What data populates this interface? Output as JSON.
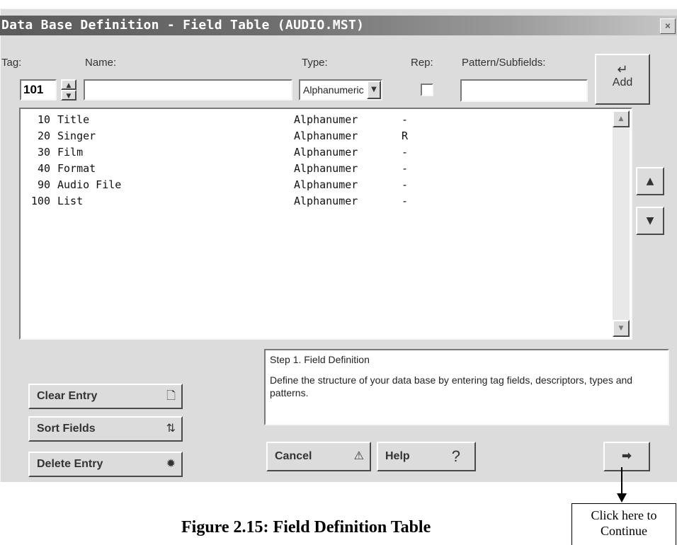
{
  "window": {
    "title": "Data Base Definition - Field Table (AUDIO.MST)",
    "close_label": "×"
  },
  "labels": {
    "tag": "Tag:",
    "name": "Name:",
    "type": "Type:",
    "rep": "Rep:",
    "pattern": "Pattern/Subfields:"
  },
  "form": {
    "tag_value": "101",
    "name_value": "",
    "type_value": "Alphanumeric",
    "rep_checked": false,
    "pattern_value": ""
  },
  "add_button": {
    "label": "Add",
    "icon": "return-arrow-icon"
  },
  "fields": [
    {
      "tag": "10",
      "name": "Title",
      "type": "Alphanumer",
      "rep": "-"
    },
    {
      "tag": "20",
      "name": "Singer",
      "type": "Alphanumer",
      "rep": "R"
    },
    {
      "tag": "30",
      "name": "Film",
      "type": "Alphanumer",
      "rep": "-"
    },
    {
      "tag": "40",
      "name": "Format",
      "type": "Alphanumer",
      "rep": "-"
    },
    {
      "tag": "90",
      "name": "Audio File",
      "type": "Alphanumer",
      "rep": "-"
    },
    {
      "tag": "100",
      "name": "List",
      "type": "Alphanumer",
      "rep": "-"
    }
  ],
  "help": {
    "title": "Step 1. Field Definition",
    "text": "Define the structure of your data base by entering tag fields, descriptors, types and patterns."
  },
  "buttons": {
    "clear_entry": "Clear Entry",
    "sort_fields": "Sort Fields",
    "delete_entry": "Delete Entry",
    "cancel": "Cancel",
    "help": "Help",
    "help_icon": "?"
  },
  "annotation": {
    "line1": "Click here to",
    "line2": "Continue"
  },
  "caption": "Figure 2.15: Field Definition Table"
}
